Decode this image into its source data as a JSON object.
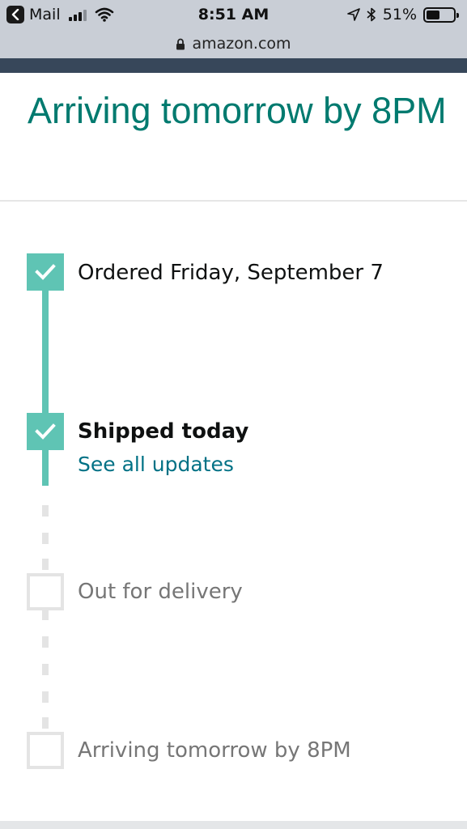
{
  "status_bar": {
    "back_app": "Mail",
    "time": "8:51 AM",
    "battery_percent": "51%",
    "battery_level": 0.51,
    "signal_bars": 3,
    "icons": [
      "back-arrow-icon",
      "signal-icon",
      "wifi-icon",
      "location-arrow-icon",
      "bluetooth-icon",
      "battery-icon"
    ]
  },
  "url_bar": {
    "url": "amazon.com",
    "icon": "lock-icon"
  },
  "heading": "Arriving tomorrow by 8PM",
  "timeline": {
    "colors": {
      "complete": "#5fc4b4",
      "pending": "#e4e4e4",
      "link": "#007185",
      "heading": "#007a6f"
    },
    "steps": [
      {
        "label": "Ordered Friday, September 7",
        "status": "complete"
      },
      {
        "label": "Shipped today",
        "status": "current",
        "link": "See all updates"
      },
      {
        "label": "Out for delivery",
        "status": "pending"
      },
      {
        "label": "Arriving tomorrow by 8PM",
        "status": "pending"
      }
    ]
  }
}
